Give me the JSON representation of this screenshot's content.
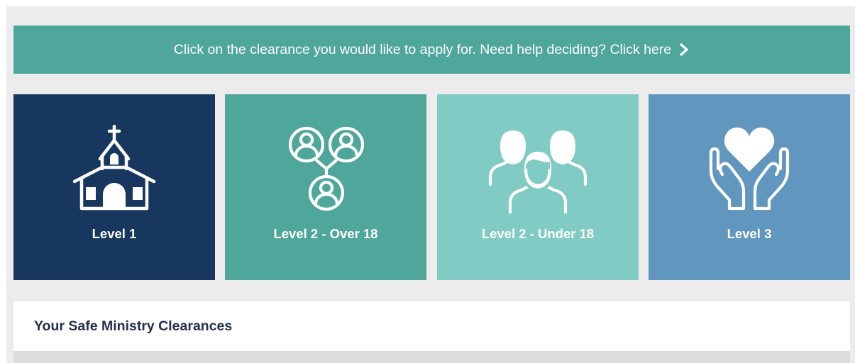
{
  "banner": {
    "text": "Click on the clearance you would like to apply for. Need help deciding? Click here",
    "icon": "chevron-right-icon"
  },
  "tiles": [
    {
      "label": "Level 1",
      "icon": "church-icon",
      "color": "#17375e"
    },
    {
      "label": "Level 2 - Over 18",
      "icon": "connected-users-icon",
      "color": "#4fa69a"
    },
    {
      "label": "Level 2 - Under 18",
      "icon": "group-people-icon",
      "color": "#80cbc3"
    },
    {
      "label": "Level 3",
      "icon": "hands-heart-icon",
      "color": "#6196be"
    }
  ],
  "clearances": {
    "title": "Your Safe Ministry Clearances"
  },
  "colors": {
    "background": "#ececec",
    "banner": "#4fa69a",
    "title_text": "#253049"
  }
}
